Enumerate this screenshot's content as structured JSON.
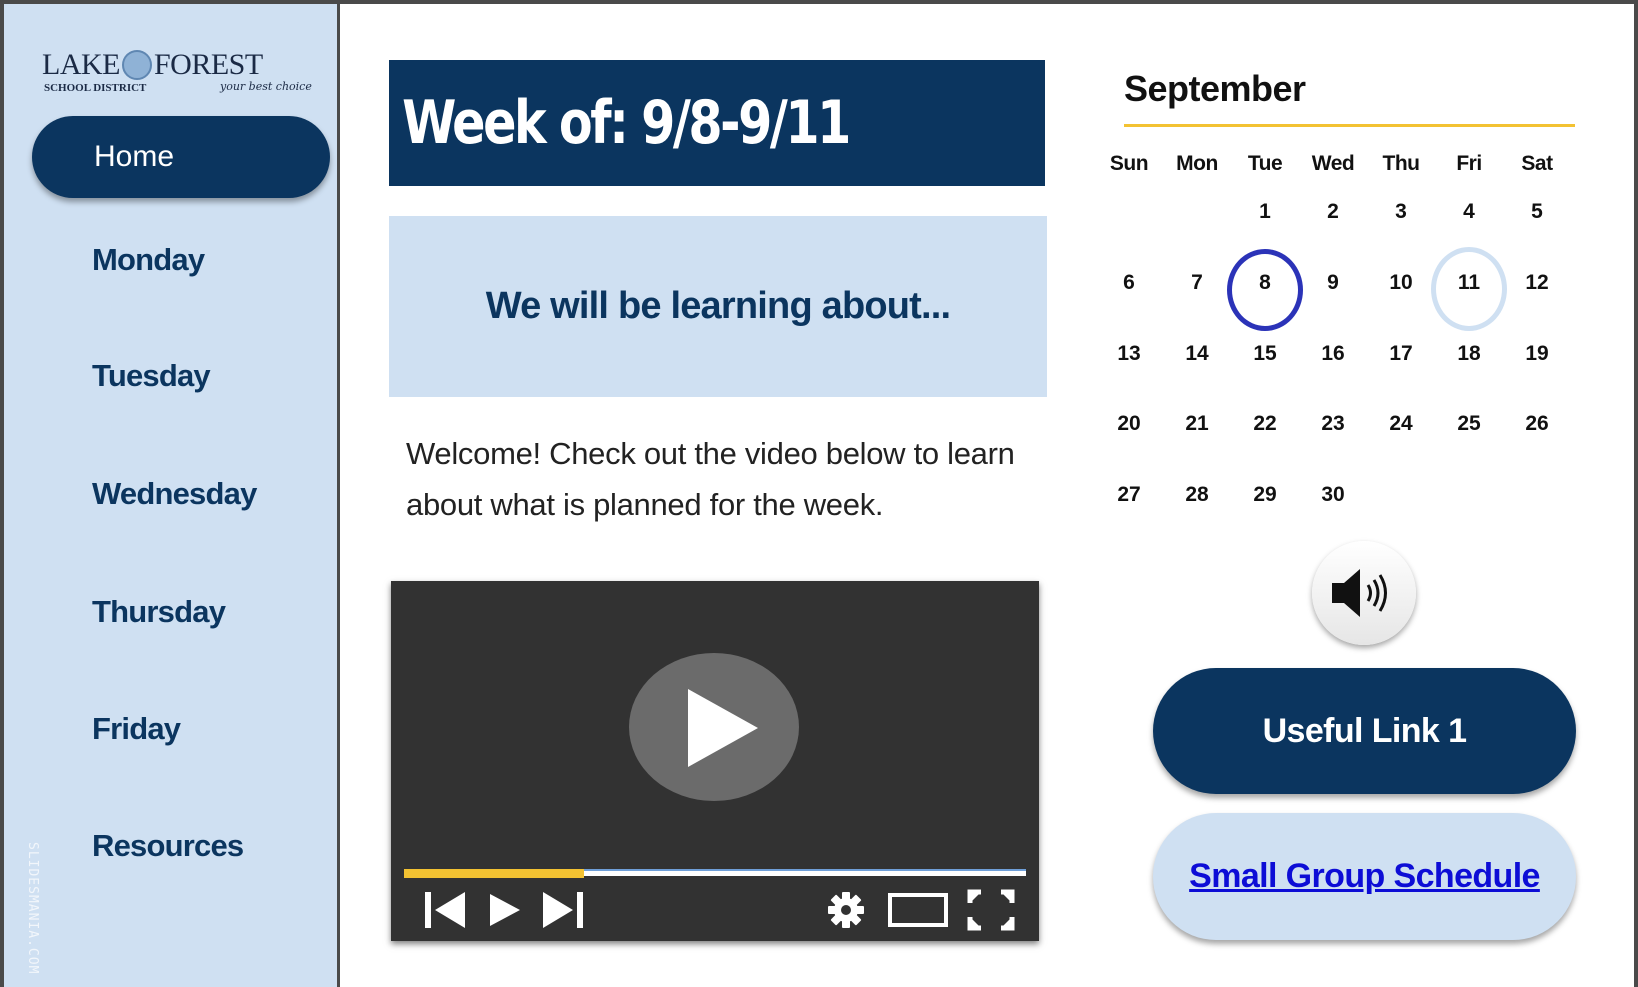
{
  "logo": {
    "main_left": "LAKE",
    "main_right": "FOREST",
    "sub": "SCHOOL DISTRICT",
    "tagline": "your best choice"
  },
  "nav": {
    "home": "Home",
    "items": [
      "Monday",
      "Tuesday",
      "Wednesday",
      "Thursday",
      "Friday",
      "Resources"
    ]
  },
  "watermark": "SLIDESMANIA.COM",
  "week_banner": "Week of:  9/8-9/11",
  "learning_heading": "We will be learning about...",
  "welcome_text": "Welcome!  Check out the video below to learn about what is  planned for the week.",
  "video": {
    "progress": 0.29,
    "controls": [
      "skip-back-icon",
      "play-icon",
      "skip-forward-icon",
      "settings-icon",
      "theater-mode-icon",
      "fullscreen-icon"
    ]
  },
  "calendar": {
    "month": "September",
    "weekdays": [
      "Sun",
      "Mon",
      "Tue",
      "Wed",
      "Thu",
      "Fri",
      "Sat"
    ],
    "first_weekday_index": 2,
    "days_in_month": 30,
    "highlighted_day": 8,
    "soft_highlighted_day": 11
  },
  "buttons": {
    "useful_link": "Useful Link 1",
    "small_group": "Small Group Schedule"
  },
  "colors": {
    "navy": "#0b355f",
    "light_blue": "#cfe0f2",
    "gold": "#f3c232",
    "ring": "#2b33b8",
    "link": "#0d0dd6"
  }
}
